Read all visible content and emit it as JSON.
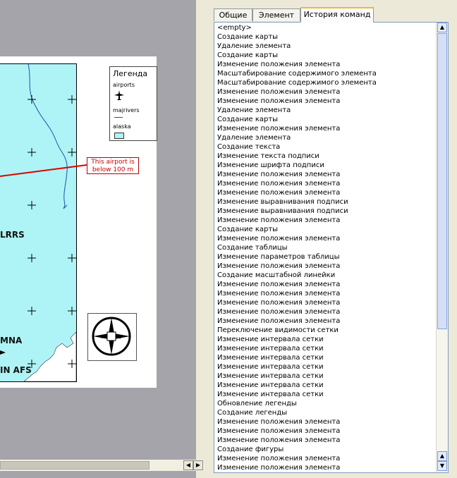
{
  "map": {
    "legend": {
      "title": "Легенда",
      "items": [
        {
          "label": "airports",
          "icon": "airplane-icon"
        },
        {
          "label": "majrivers",
          "icon": "river-line-icon"
        },
        {
          "label": "alaska",
          "icon": "land-swatch-icon"
        }
      ]
    },
    "callout": {
      "line1": "This airport is",
      "line2": "below 100 m"
    },
    "labels": {
      "lrrs": "LRRS",
      "mna": "MNA",
      "afs": "IN AFS"
    },
    "compass_letters": {
      "n": "N",
      "s": "S",
      "e": "E",
      "w": "W"
    },
    "colors": {
      "land": "#aef4f6",
      "callout_line": "#e00000",
      "canvas_bg": "#a5a4aa",
      "river": "#2050a0"
    }
  },
  "panel": {
    "tabs": [
      {
        "label": "Общие",
        "active": false
      },
      {
        "label": "Элемент",
        "active": false
      },
      {
        "label": "История команд",
        "active": true
      }
    ],
    "history": [
      "<empty>",
      "Создание карты",
      "Удаление элемента",
      "Создание карты",
      "Изменение положения элемента",
      "Масштабирование содержимого элемента",
      "Масштабирование содержимого элемента",
      "Изменение положения элемента",
      "Изменение положения элемента",
      "Удаление элемента",
      "Создание карты",
      "Изменение положения элемента",
      "Удаление элемента",
      "Создание текста",
      "Изменение текста подписи",
      "Изменение шрифта подписи",
      "Изменение положения элемента",
      "Изменение положения элемента",
      "Изменение положения элемента",
      "Изменение выравнивания подписи",
      "Изменение выравнивания подписи",
      "Изменение положения элемента",
      "Создание карты",
      "Изменение положения элемента",
      "Создание таблицы",
      "Изменение параметров таблицы",
      "Изменение положения элемента",
      "Создание масштабной линейки",
      "Изменение положения элемента",
      "Изменение положения элемента",
      "Изменение положения элемента",
      "Изменение положения элемента",
      "Изменение положения элемента",
      "Переключение видимости сетки",
      "Изменение интервала сетки",
      "Изменение интервала сетки",
      "Изменение интервала сетки",
      "Изменение интервала сетки",
      "Изменение интервала сетки",
      "Изменение интервала сетки",
      "Изменение интервала сетки",
      "Обновление легенды",
      "Создание легенды",
      "Изменение положения элемента",
      "Изменение положения элемента",
      "Изменение положения элемента",
      "Создание фигуры",
      "Изменение положения элемента",
      "Изменение положения элемента"
    ]
  }
}
